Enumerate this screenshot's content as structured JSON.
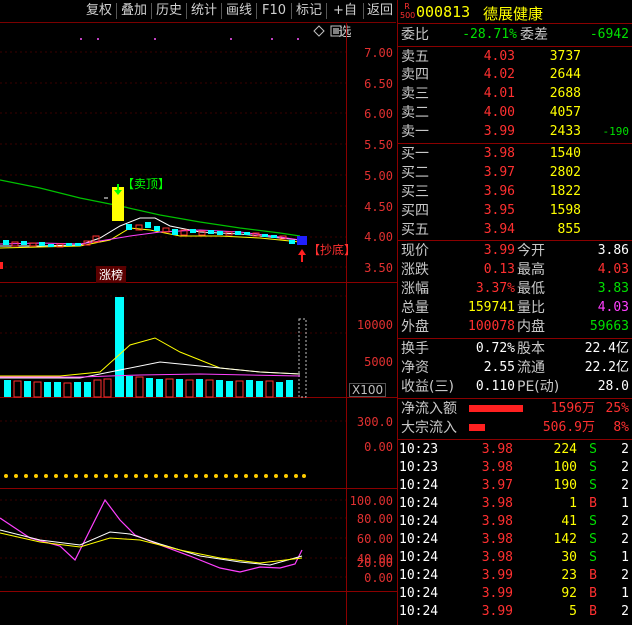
{
  "toolbar": {
    "buttons": [
      "复权",
      "叠加",
      "历史",
      "统计",
      "画线",
      "F10",
      "标记",
      "+自选",
      "返回"
    ]
  },
  "chart": {
    "price_ticks": [
      "7.00",
      "6.50",
      "6.00",
      "5.50",
      "5.00",
      "4.50",
      "4.00",
      "3.50"
    ],
    "volume_ticks": [
      "10000",
      "5000"
    ],
    "volume_unit": "X100",
    "flow_ticks": [
      "300.0",
      "0.00"
    ],
    "indicator_ticks": [
      "100.00",
      "80.00",
      "60.00",
      "40.00",
      "20.00",
      "0.00"
    ],
    "sell_top_label": "卖顶",
    "buy_bottom_label": "抄底",
    "limit_up_label": "涨榜",
    "colors": {
      "up": "#ff3030",
      "down": "#00ffff",
      "ma_white": "#ffffff",
      "ma_yellow": "#ffff00",
      "ma_magenta": "#ff40ff",
      "ma_green": "#00c000"
    }
  },
  "stock": {
    "market_badge_top": "R",
    "market_badge_bottom": "500",
    "code": "000813",
    "name": "德展健康"
  },
  "order_ratio": {
    "label1": "委比",
    "value1": "-28.71%",
    "label2": "委差",
    "value2": "-6942"
  },
  "asks": [
    {
      "label": "卖五",
      "price": "4.03",
      "volume": "3737",
      "change": ""
    },
    {
      "label": "卖四",
      "price": "4.02",
      "volume": "2644",
      "change": ""
    },
    {
      "label": "卖三",
      "price": "4.01",
      "volume": "2688",
      "change": ""
    },
    {
      "label": "卖二",
      "price": "4.00",
      "volume": "4057",
      "change": ""
    },
    {
      "label": "卖一",
      "price": "3.99",
      "volume": "2433",
      "change": "-190"
    }
  ],
  "bids": [
    {
      "label": "买一",
      "price": "3.98",
      "volume": "1540"
    },
    {
      "label": "买二",
      "price": "3.97",
      "volume": "2802"
    },
    {
      "label": "买三",
      "price": "3.96",
      "volume": "1822"
    },
    {
      "label": "买四",
      "price": "3.95",
      "volume": "1598"
    },
    {
      "label": "买五",
      "price": "3.94",
      "volume": "855"
    }
  ],
  "quote": [
    {
      "l1": "现价",
      "v1": "3.99",
      "c1": "red",
      "l2": "今开",
      "v2": "3.86",
      "c2": "white"
    },
    {
      "l1": "涨跌",
      "v1": "0.13",
      "c1": "red",
      "l2": "最高",
      "v2": "4.03",
      "c2": "red"
    },
    {
      "l1": "涨幅",
      "v1": "3.37%",
      "c1": "red",
      "l2": "最低",
      "v2": "3.83",
      "c2": "green"
    },
    {
      "l1": "总量",
      "v1": "159741",
      "c1": "yellow",
      "l2": "量比",
      "v2": "4.03",
      "c2": "magenta"
    },
    {
      "l1": "外盘",
      "v1": "100078",
      "c1": "red",
      "l2": "内盘",
      "v2": "59663",
      "c2": "green"
    }
  ],
  "fundamentals": [
    {
      "l1": "换手",
      "v1": "0.72%",
      "l2": "股本",
      "v2": "22.4亿"
    },
    {
      "l1": "净资",
      "v1": "2.55",
      "l2": "流通",
      "v2": "22.2亿"
    },
    {
      "l1": "收益(三)",
      "v1": "0.110",
      "l2": "PE(动)",
      "v2": "28.0"
    }
  ],
  "flows": [
    {
      "label": "净流入额",
      "value": "1596万",
      "pct": "25%",
      "bar_fraction": 1.0
    },
    {
      "label": "大宗流入",
      "value": "506.9万",
      "pct": "8%",
      "bar_fraction": 0.3
    }
  ],
  "ticks": [
    {
      "time": "10:23",
      "price": "3.98",
      "vol": "224",
      "side": "S",
      "n": "2"
    },
    {
      "time": "10:23",
      "price": "3.98",
      "vol": "100",
      "side": "S",
      "n": "2"
    },
    {
      "time": "10:24",
      "price": "3.97",
      "vol": "190",
      "side": "S",
      "n": "2"
    },
    {
      "time": "10:24",
      "price": "3.98",
      "vol": "1",
      "side": "B",
      "n": "1"
    },
    {
      "time": "10:24",
      "price": "3.98",
      "vol": "41",
      "side": "S",
      "n": "2"
    },
    {
      "time": "10:24",
      "price": "3.98",
      "vol": "142",
      "side": "S",
      "n": "2"
    },
    {
      "time": "10:24",
      "price": "3.98",
      "vol": "30",
      "side": "S",
      "n": "1"
    },
    {
      "time": "10:24",
      "price": "3.99",
      "vol": "23",
      "side": "B",
      "n": "2"
    },
    {
      "time": "10:24",
      "price": "3.99",
      "vol": "92",
      "side": "B",
      "n": "1"
    },
    {
      "time": "10:24",
      "price": "3.99",
      "vol": "5",
      "side": "B",
      "n": "2"
    }
  ]
}
